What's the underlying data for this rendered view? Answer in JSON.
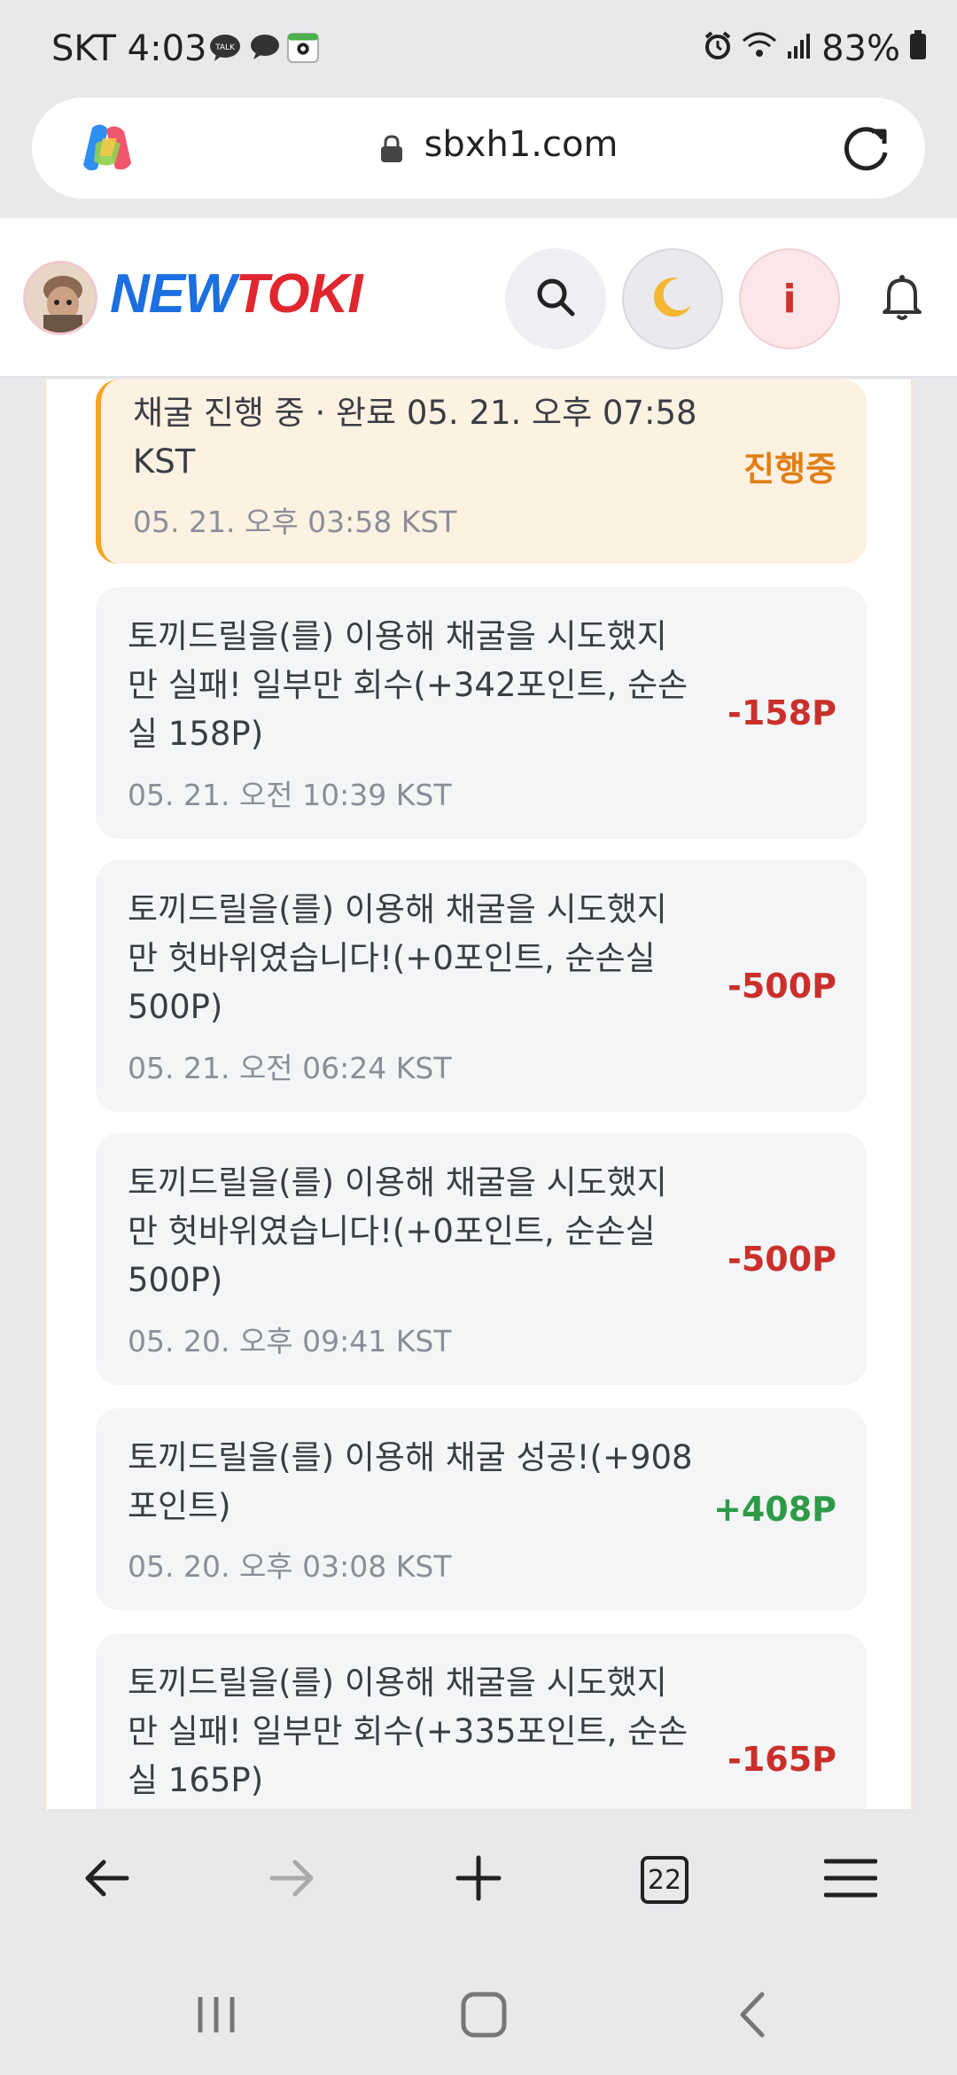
{
  "status_bar": {
    "time_carrier": "SKT 4:03",
    "battery": "83%",
    "icons": [
      "talk-icon",
      "chat-bubble-icon",
      "map-pin-icon",
      "alarm-icon",
      "wifi-icon",
      "signal-icon",
      "battery-icon"
    ]
  },
  "browser": {
    "url": "sbxh1.com",
    "tab_count": "22"
  },
  "site": {
    "logo_part1": "NEW",
    "logo_part2": "TOKI",
    "info_button": "i"
  },
  "entries": [
    {
      "text": "채굴 진행 중 · 완료 05. 21. 오후 07:58 KST",
      "date": "05. 21. 오후 03:58 KST",
      "amount": "진행중",
      "kind": "status"
    },
    {
      "text": "토끼드릴을(를) 이용해 채굴을 시도했지만 실패! 일부만 회수(+342포인트, 순손실 158P)",
      "date": "05. 21. 오전 10:39 KST",
      "amount": "-158P",
      "kind": "neg"
    },
    {
      "text": "토끼드릴을(를) 이용해 채굴을 시도했지만 헛바위였습니다!(+0포인트, 순손실 500P)",
      "date": "05. 21. 오전 06:24 KST",
      "amount": "-500P",
      "kind": "neg"
    },
    {
      "text": "토끼드릴을(를) 이용해 채굴을 시도했지만 헛바위였습니다!(+0포인트, 순손실 500P)",
      "date": "05. 20. 오후 09:41 KST",
      "amount": "-500P",
      "kind": "neg"
    },
    {
      "text": "토끼드릴을(를) 이용해 채굴 성공!(+908포인트)",
      "date": "05. 20. 오후 03:08 KST",
      "amount": "+408P",
      "kind": "pos"
    },
    {
      "text": "토끼드릴을(를) 이용해 채굴을 시도했지만 실패! 일부만 회수(+335포인트, 순손실 165P)",
      "date": "",
      "amount": "-165P",
      "kind": "neg"
    }
  ]
}
